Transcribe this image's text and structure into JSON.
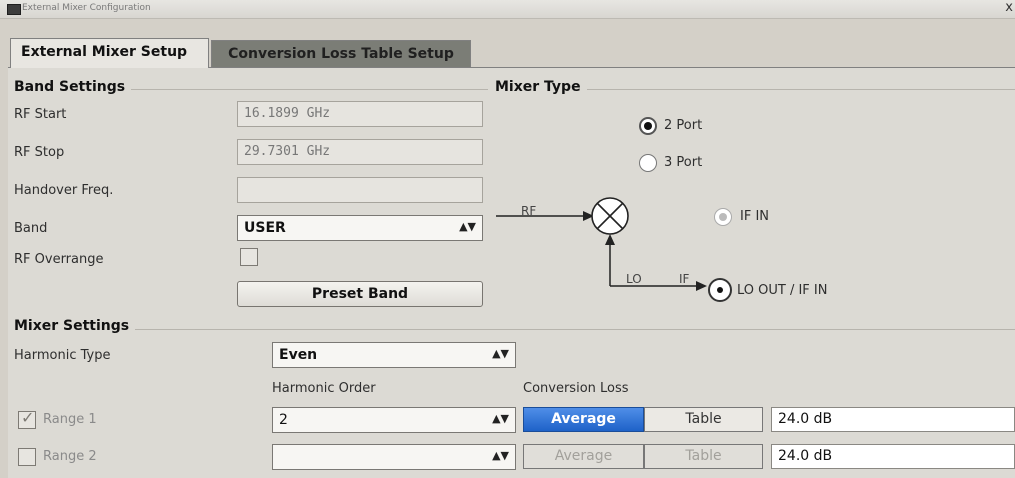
{
  "window": {
    "title": "External Mixer Configuration",
    "close_symbol": "x"
  },
  "tabs": [
    {
      "label": "External Mixer Setup",
      "active": true
    },
    {
      "label": "Conversion Loss Table Setup",
      "active": false
    }
  ],
  "band_settings": {
    "title": "Band Settings",
    "rf_start_label": "RF Start",
    "rf_start_value": "16.1899 GHz",
    "rf_stop_label": "RF Stop",
    "rf_stop_value": "29.7301 GHz",
    "handover_label": "Handover Freq.",
    "handover_value": "",
    "band_label": "Band",
    "band_value": "USER",
    "overrange_label": "RF Overrange",
    "preset_button": "Preset Band"
  },
  "mixer_type": {
    "title": "Mixer Type",
    "option_2_port": "2 Port",
    "option_3_port": "3 Port",
    "selected": "2 Port",
    "rf_label": "RF",
    "lo_label": "LO",
    "if_label": "IF",
    "if_in_label": "IF IN",
    "lo_out_label": "LO OUT / IF IN"
  },
  "mixer_settings": {
    "title": "Mixer Settings",
    "harmonic_type_label": "Harmonic Type",
    "harmonic_type_value": "Even",
    "harmonic_order_header": "Harmonic Order",
    "conversion_loss_header": "Conversion Loss",
    "ranges": [
      {
        "label": "Range 1",
        "checked": true,
        "harmonic_order": "2",
        "average_label": "Average",
        "table_label": "Table",
        "mode": "Average",
        "value": "24.0 dB"
      },
      {
        "label": "Range 2",
        "checked": false,
        "harmonic_order": "",
        "average_label": "Average",
        "table_label": "Table",
        "mode": "none",
        "value": "24.0 dB"
      }
    ]
  }
}
